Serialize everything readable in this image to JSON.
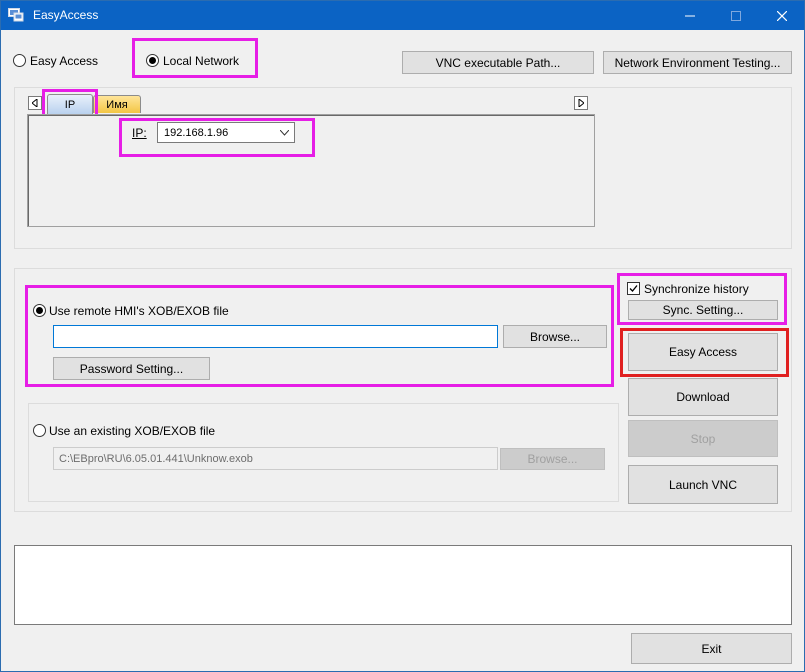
{
  "window": {
    "title": "EasyAccess"
  },
  "mode": {
    "easy_access_label": "Easy Access",
    "local_network_label": "Local Network"
  },
  "top_buttons": {
    "vnc_path": "VNC executable Path...",
    "network_testing": "Network Environment Testing..."
  },
  "tabs": [
    {
      "label": "IP"
    },
    {
      "label": "Имя"
    }
  ],
  "ip": {
    "label": "IP:",
    "value": "192.168.1.96"
  },
  "remote": {
    "label": "Use remote HMI's XOB/EXOB file",
    "path_value": "",
    "browse_label": "Browse...",
    "password_label": "Password Setting..."
  },
  "existing": {
    "label": "Use an existing XOB/EXOB file",
    "path_value": "C:\\EBpro\\RU\\6.05.01.441\\Unknow.exob",
    "browse_label": "Browse..."
  },
  "sync": {
    "label": "Synchronize history",
    "setting_label": "Sync. Setting..."
  },
  "actions": {
    "easy_access": "Easy Access",
    "download": "Download",
    "stop": "Stop",
    "launch_vnc": "Launch VNC"
  },
  "log": {
    "value": ""
  },
  "exit_label": "Exit"
}
